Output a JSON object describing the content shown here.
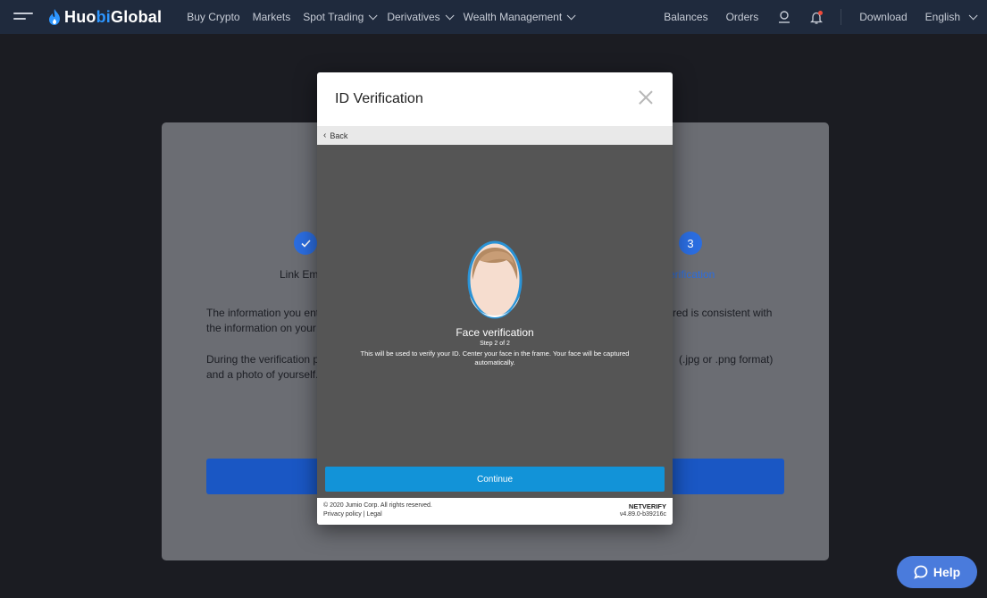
{
  "nav": {
    "logo_main": "Huo",
    "logo_accent": "bi",
    "logo_suffix": " Global",
    "items": [
      "Buy Crypto",
      "Markets",
      "Spot Trading",
      "Derivatives",
      "Wealth Management"
    ],
    "right_items": {
      "balances": "Balances",
      "orders": "Orders",
      "download": "Download",
      "language": "English"
    }
  },
  "background": {
    "step1_icon": "check-icon",
    "step3_number": "3",
    "step1_label_partial": "Link Em",
    "step3_label_partial": "erification",
    "para1_left_a": "The information you ent",
    "para1_left_b": "the information on your",
    "para1_right": "red is consistent with",
    "para2_left_a": "During the verification p",
    "para2_left_b": "and a photo of yourself.",
    "para2_right": "(.jpg or .png format)"
  },
  "modal": {
    "title": "ID Verification",
    "back_label": "Back",
    "face_title": "Face verification",
    "step": "Step 2 of 2",
    "description": "This will be used to verify your ID. Center your face in the frame. Your face will be captured automatically.",
    "continue_label": "Continue",
    "footer_copyright": "© 2020 Jumio Corp. All rights reserved.",
    "footer_links": "Privacy policy | Legal",
    "footer_brand": "NETVERIFY",
    "footer_version": "v4.89.0-b39216c"
  },
  "help": {
    "label": "Help"
  },
  "colors": {
    "accent": "#2b6de0",
    "nav_bg": "#1f2a3d",
    "continue": "#1293d8",
    "help": "#4a7bdc"
  }
}
